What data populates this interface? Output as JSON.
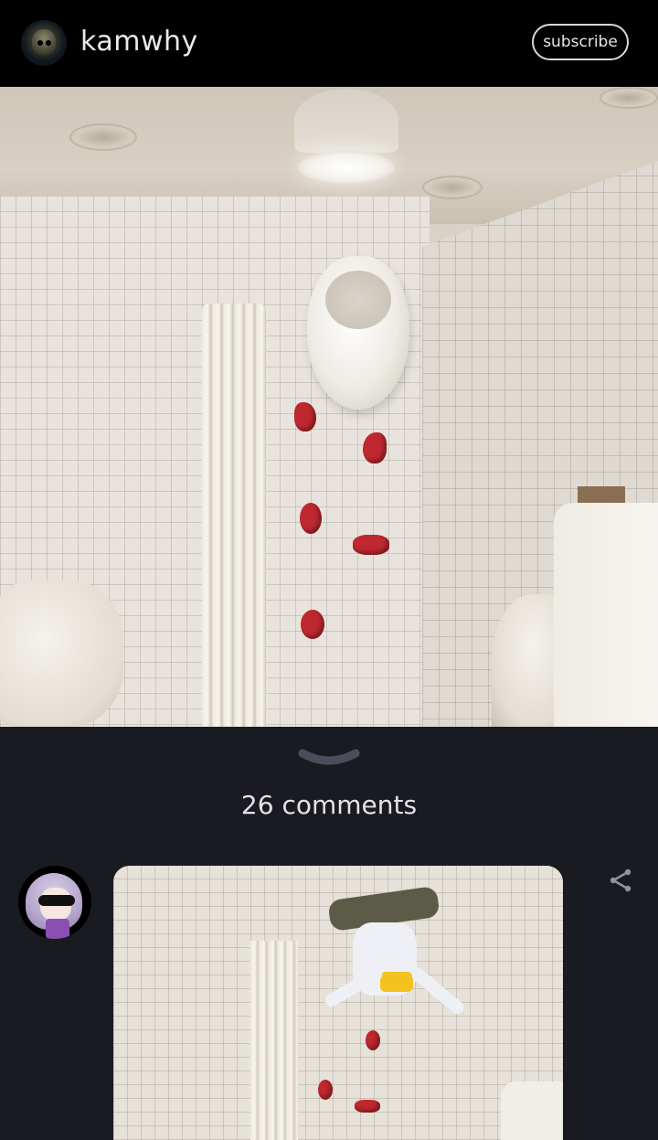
{
  "header": {
    "username": "kamwhy",
    "subscribe_label": "subscribe"
  },
  "post": {
    "image_subject": "bathroom-wall-with-climbing-holds-and-high-urinal"
  },
  "comments": {
    "count_label": "26 comments"
  },
  "comment": {
    "image_subject": "edited-photo-with-cartoon-figure-climbing"
  },
  "colors": {
    "background": "#1a1b21",
    "header": "#000000",
    "text": "#e6e6ea",
    "climbing_hold": "#c0282f"
  },
  "icons": [
    "channel-avatar",
    "collapse-chevron-icon",
    "share-icon",
    "commenter-avatar"
  ]
}
